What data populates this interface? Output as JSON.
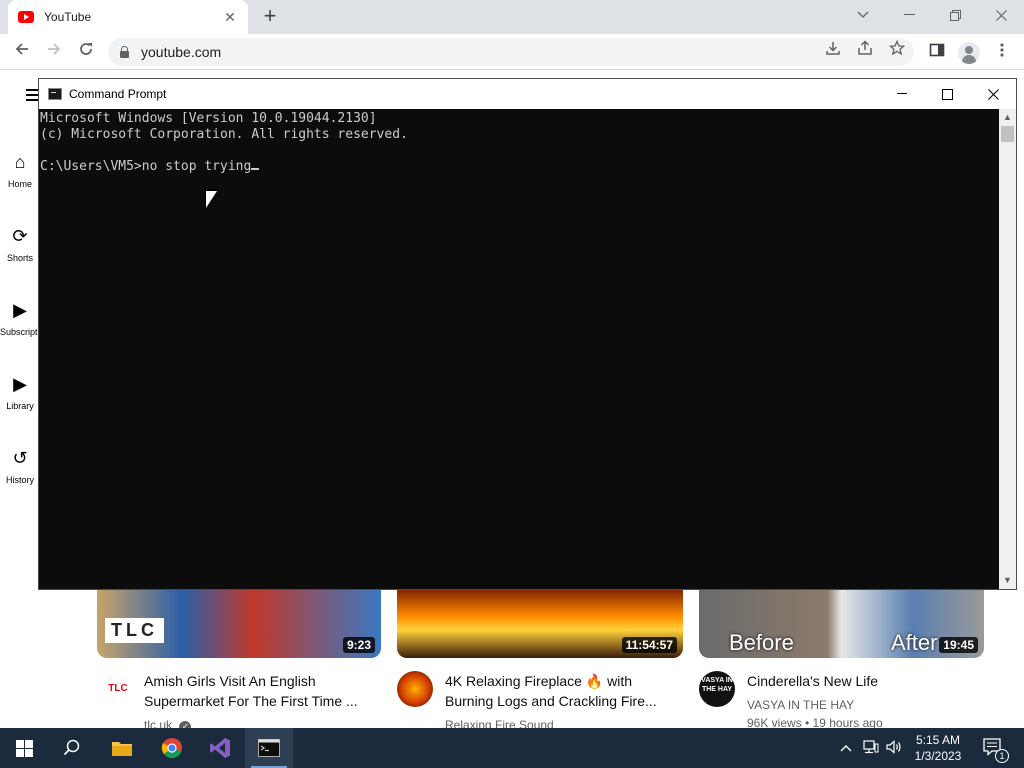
{
  "browser": {
    "tab_title": "YouTube",
    "tab_close": "✕",
    "new_tab": "+",
    "url": "youtube.com"
  },
  "youtube": {
    "sidebar": [
      {
        "label": "Home",
        "icon": "⌂"
      },
      {
        "label": "Shorts",
        "icon": "⟳"
      },
      {
        "label": "Subscriptions",
        "icon": "▶"
      },
      {
        "label": "Library",
        "icon": "▶"
      },
      {
        "label": "History",
        "icon": "↺"
      }
    ],
    "videos": [
      {
        "title": "Amish Girls Visit An English Supermarket For The First Time ...",
        "channel": "tlc.uk",
        "duration": "9:23",
        "avatar_text": "TLC",
        "thumb_text": "TLC",
        "verified": "✓"
      },
      {
        "title": "4K Relaxing Fireplace 🔥 with Burning Logs and Crackling Fire...",
        "channel": "Relaxing Fire Sound",
        "duration": "11:54:57"
      },
      {
        "title": "Cinderella's New Life",
        "channel": "VASYA IN THE HAY",
        "stats": "96K views • 19 hours ago",
        "duration": "19:45",
        "avatar_text": "VASYA IN THE HAY",
        "thumb_left": "Before",
        "thumb_right": "After"
      }
    ]
  },
  "cmd": {
    "title": "Command Prompt",
    "lines": [
      "Microsoft Windows [Version 10.0.19044.2130]",
      "(c) Microsoft Corporation. All rights reserved.",
      "",
      "C:\\Users\\VM5>no stop trying"
    ]
  },
  "taskbar": {
    "time": "5:15 AM",
    "date": "1/3/2023",
    "notification_count": "1"
  },
  "colors": {
    "youtube_red": "#ff0000",
    "console_bg": "#0c0c0c",
    "console_fg": "#cccccc",
    "taskbar_bg": "#1b2a3c"
  }
}
